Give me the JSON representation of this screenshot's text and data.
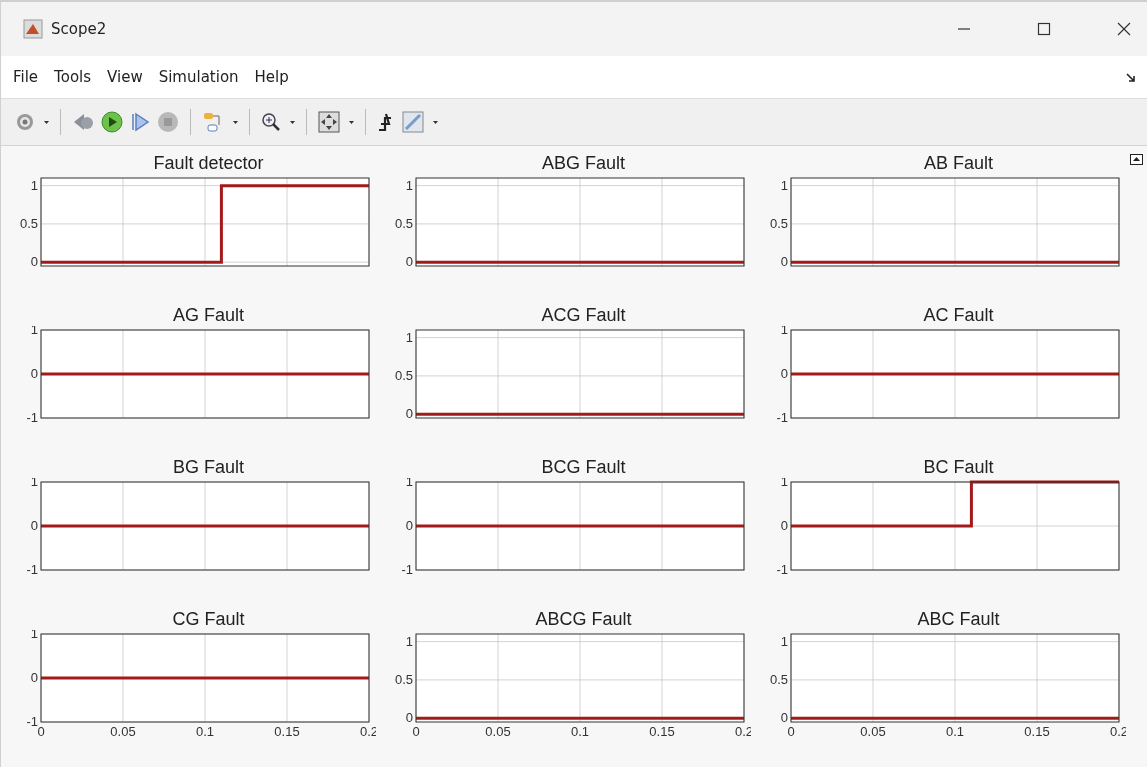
{
  "window": {
    "title": "Scope2"
  },
  "menu": [
    "File",
    "Tools",
    "View",
    "Simulation",
    "Help"
  ],
  "plots": [
    {
      "chart_data": {
        "type": "line",
        "title": "Fault detector",
        "x": [
          0,
          0.11,
          0.11,
          0.2
        ],
        "series": [
          {
            "color": "#a31a1a",
            "values": [
              0,
              0,
              1,
              1
            ]
          }
        ],
        "xlim": [
          0,
          0.2
        ],
        "ylim": [
          -0.05,
          1.1
        ],
        "yticks": [
          0,
          0.5,
          1
        ],
        "grid": true
      }
    },
    {
      "chart_data": {
        "type": "line",
        "title": "ABG Fault",
        "x": [
          0,
          0.2
        ],
        "series": [
          {
            "color": "#a31a1a",
            "values": [
              0,
              0
            ]
          }
        ],
        "xlim": [
          0,
          0.2
        ],
        "ylim": [
          -0.05,
          1.1
        ],
        "yticks": [
          0,
          0.5,
          1
        ],
        "grid": true
      }
    },
    {
      "chart_data": {
        "type": "line",
        "title": "AB Fault",
        "x": [
          0,
          0.2
        ],
        "series": [
          {
            "color": "#a31a1a",
            "values": [
              0,
              0
            ]
          }
        ],
        "xlim": [
          0,
          0.2
        ],
        "ylim": [
          -0.05,
          1.1
        ],
        "yticks": [
          0,
          0.5,
          1
        ],
        "grid": true
      }
    },
    {
      "chart_data": {
        "type": "line",
        "title": "AG Fault",
        "x": [
          0,
          0.2
        ],
        "series": [
          {
            "color": "#a31a1a",
            "values": [
              0,
              0
            ]
          }
        ],
        "xlim": [
          0,
          0.2
        ],
        "ylim": [
          -1,
          1
        ],
        "yticks": [
          -1,
          0,
          1
        ],
        "grid": true
      }
    },
    {
      "chart_data": {
        "type": "line",
        "title": "ACG Fault",
        "x": [
          0,
          0.2
        ],
        "series": [
          {
            "color": "#a31a1a",
            "values": [
              0,
              0
            ]
          }
        ],
        "xlim": [
          0,
          0.2
        ],
        "ylim": [
          -0.05,
          1.1
        ],
        "yticks": [
          0,
          0.5,
          1
        ],
        "grid": true
      }
    },
    {
      "chart_data": {
        "type": "line",
        "title": "AC Fault",
        "x": [
          0,
          0.2
        ],
        "series": [
          {
            "color": "#a31a1a",
            "values": [
              0,
              0
            ]
          }
        ],
        "xlim": [
          0,
          0.2
        ],
        "ylim": [
          -1,
          1
        ],
        "yticks": [
          -1,
          0,
          1
        ],
        "grid": true
      }
    },
    {
      "chart_data": {
        "type": "line",
        "title": "BG Fault",
        "x": [
          0,
          0.2
        ],
        "series": [
          {
            "color": "#a31a1a",
            "values": [
              0,
              0
            ]
          }
        ],
        "xlim": [
          0,
          0.2
        ],
        "ylim": [
          -1,
          1
        ],
        "yticks": [
          -1,
          0,
          1
        ],
        "grid": true
      }
    },
    {
      "chart_data": {
        "type": "line",
        "title": "BCG Fault",
        "x": [
          0,
          0.2
        ],
        "series": [
          {
            "color": "#a31a1a",
            "values": [
              0,
              0
            ]
          }
        ],
        "xlim": [
          0,
          0.2
        ],
        "ylim": [
          -1,
          1
        ],
        "yticks": [
          -1,
          0,
          1
        ],
        "grid": true
      }
    },
    {
      "chart_data": {
        "type": "line",
        "title": "BC Fault",
        "x": [
          0,
          0.11,
          0.11,
          0.2
        ],
        "series": [
          {
            "color": "#a31a1a",
            "values": [
              0,
              0,
              1,
              1
            ]
          }
        ],
        "xlim": [
          0,
          0.2
        ],
        "ylim": [
          -1,
          1
        ],
        "yticks": [
          -1,
          0,
          1
        ],
        "grid": true
      }
    },
    {
      "chart_data": {
        "type": "line",
        "title": "CG Fault",
        "x": [
          0,
          0.2
        ],
        "series": [
          {
            "color": "#a31a1a",
            "values": [
              0,
              0
            ]
          }
        ],
        "xlim": [
          0,
          0.2
        ],
        "ylim": [
          -1,
          1
        ],
        "xticks": [
          0,
          0.05,
          0.1,
          0.15,
          0.2
        ],
        "yticks": [
          -1,
          0,
          1
        ],
        "grid": true
      }
    },
    {
      "chart_data": {
        "type": "line",
        "title": "ABCG Fault",
        "x": [
          0,
          0.2
        ],
        "series": [
          {
            "color": "#a31a1a",
            "values": [
              0,
              0
            ]
          }
        ],
        "xlim": [
          0,
          0.2
        ],
        "ylim": [
          -0.05,
          1.1
        ],
        "xticks": [
          0,
          0.05,
          0.1,
          0.15,
          0.2
        ],
        "yticks": [
          0,
          0.5,
          1
        ],
        "grid": true
      }
    },
    {
      "chart_data": {
        "type": "line",
        "title": "ABC Fault",
        "x": [
          0,
          0.2
        ],
        "series": [
          {
            "color": "#a31a1a",
            "values": [
              0,
              0
            ]
          }
        ],
        "xlim": [
          0,
          0.2
        ],
        "ylim": [
          -0.05,
          1.1
        ],
        "xticks": [
          0,
          0.05,
          0.1,
          0.15,
          0.2
        ],
        "yticks": [
          0,
          0.5,
          1
        ],
        "grid": true
      }
    }
  ]
}
